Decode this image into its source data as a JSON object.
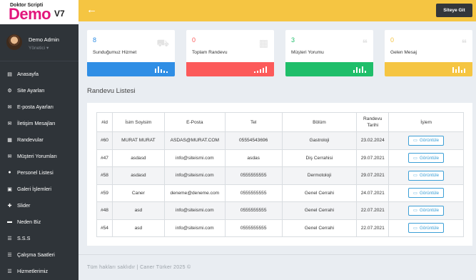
{
  "brand": {
    "top": "Doktor Scripti",
    "main": "Demo",
    "tag": "V7"
  },
  "user": {
    "name": "Demo Admin",
    "role": "Yönetici"
  },
  "sidebar": {
    "items": [
      {
        "label": "Anasayfa",
        "icon": "dashboard-icon"
      },
      {
        "label": "Site Ayarları",
        "icon": "gear-icon"
      },
      {
        "label": "E-posta Ayarları",
        "icon": "envelope-icon"
      },
      {
        "label": "İletişim Mesajları",
        "icon": "envelope-icon"
      },
      {
        "label": "Randevular",
        "icon": "calendar-icon"
      },
      {
        "label": "Müşteri Yorumları",
        "icon": "envelope-icon"
      },
      {
        "label": "Personel Listesi",
        "icon": "users-icon"
      },
      {
        "label": "Galeri İşlemleri",
        "icon": "images-icon"
      },
      {
        "label": "Slider",
        "icon": "puzzle-icon"
      },
      {
        "label": "Neden Biz",
        "icon": "bookmark-icon"
      },
      {
        "label": "S.S.S",
        "icon": "list-icon"
      },
      {
        "label": "Çalışma Saatleri",
        "icon": "list-icon"
      },
      {
        "label": "Hizmetlerimiz",
        "icon": "list-icon"
      }
    ]
  },
  "topbar": {
    "back_icon": "arrow-left-icon",
    "site_button": "Siteye Git"
  },
  "cards": [
    {
      "value": "8",
      "label": "Sunduğumuz Hizmet",
      "color": "#2f8ee5",
      "icon": "truck-icon"
    },
    {
      "value": "0",
      "label": "Toplam Randevu",
      "color": "#fc5a5a",
      "icon": "calendar-icon"
    },
    {
      "value": "3",
      "label": "Müşteri Yorumu",
      "color": "#1fbe6a",
      "icon": "comments-icon"
    },
    {
      "value": "0",
      "label": "Gelen Mesaj",
      "color": "#f5c542",
      "icon": "comments-icon"
    }
  ],
  "panel": {
    "title": "Randevu Listesi",
    "columns": [
      "#id",
      "İsim Soyisim",
      "E-Posta",
      "Tel",
      "Bölüm",
      "Randevu Tarihi",
      "İşlem"
    ],
    "view_label": "Görüntüle",
    "rows": [
      [
        "#60",
        "MURAT MURAT",
        "ASDAS@MURAT.COM",
        "05554543696",
        "Gastroloji",
        "23.02.2024"
      ],
      [
        "#47",
        "asdasd",
        "info@siteismi.com",
        "asdas",
        "Diş Cerrahisi",
        "29.07.2021"
      ],
      [
        "#58",
        "asdasd",
        "info@siteismi.com",
        "0555555555",
        "Dermotoloji",
        "29.07.2021"
      ],
      [
        "#59",
        "Caner",
        "deneme@deneme.com",
        "0555555555",
        "Genel Cerrahi",
        "24.07.2021"
      ],
      [
        "#48",
        "asd",
        "info@siteismi.com",
        "0555555555",
        "Genel Cerrahi",
        "22.07.2021"
      ],
      [
        "#54",
        "asd",
        "info@siteismi.com",
        "0555555555",
        "Genel Cerrahi",
        "22.07.2021"
      ]
    ]
  },
  "footer": {
    "text": "Tüm hakları saklıdır | Caner Türker 2025 ©"
  }
}
